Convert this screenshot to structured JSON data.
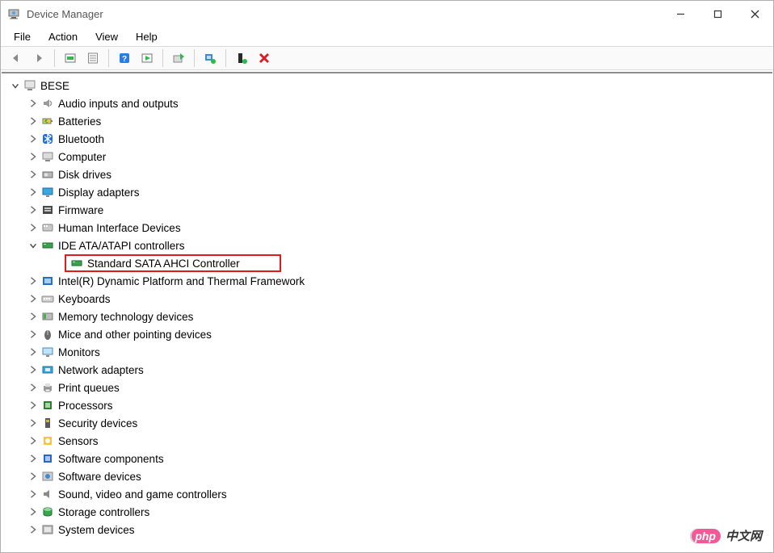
{
  "window": {
    "title": "Device Manager"
  },
  "menus": {
    "file": "File",
    "action": "Action",
    "view": "View",
    "help": "Help"
  },
  "root": {
    "label": "BESE",
    "expanded": true
  },
  "categories": [
    {
      "key": "audio",
      "label": "Audio inputs and outputs",
      "expanded": false
    },
    {
      "key": "batteries",
      "label": "Batteries",
      "expanded": false
    },
    {
      "key": "bluetooth",
      "label": "Bluetooth",
      "expanded": false
    },
    {
      "key": "computer",
      "label": "Computer",
      "expanded": false
    },
    {
      "key": "diskdrives",
      "label": "Disk drives",
      "expanded": false
    },
    {
      "key": "display",
      "label": "Display adapters",
      "expanded": false
    },
    {
      "key": "firmware",
      "label": "Firmware",
      "expanded": false
    },
    {
      "key": "hid",
      "label": "Human Interface Devices",
      "expanded": false
    },
    {
      "key": "ide",
      "label": "IDE ATA/ATAPI controllers",
      "expanded": true,
      "children": [
        {
          "key": "sata",
          "label": "Standard SATA AHCI Controller",
          "highlight": true
        }
      ]
    },
    {
      "key": "intel",
      "label": "Intel(R) Dynamic Platform and Thermal Framework",
      "expanded": false
    },
    {
      "key": "keyboards",
      "label": "Keyboards",
      "expanded": false
    },
    {
      "key": "memtech",
      "label": "Memory technology devices",
      "expanded": false
    },
    {
      "key": "mice",
      "label": "Mice and other pointing devices",
      "expanded": false
    },
    {
      "key": "monitors",
      "label": "Monitors",
      "expanded": false
    },
    {
      "key": "network",
      "label": "Network adapters",
      "expanded": false
    },
    {
      "key": "print",
      "label": "Print queues",
      "expanded": false
    },
    {
      "key": "processors",
      "label": "Processors",
      "expanded": false
    },
    {
      "key": "security",
      "label": "Security devices",
      "expanded": false
    },
    {
      "key": "sensors",
      "label": "Sensors",
      "expanded": false
    },
    {
      "key": "swcomp",
      "label": "Software components",
      "expanded": false
    },
    {
      "key": "swdev",
      "label": "Software devices",
      "expanded": false
    },
    {
      "key": "sound",
      "label": "Sound, video and game controllers",
      "expanded": false
    },
    {
      "key": "storage",
      "label": "Storage controllers",
      "expanded": false
    },
    {
      "key": "sysdev",
      "label": "System devices",
      "expanded": false
    }
  ],
  "watermark": {
    "badge": "php",
    "text": "中文网"
  }
}
